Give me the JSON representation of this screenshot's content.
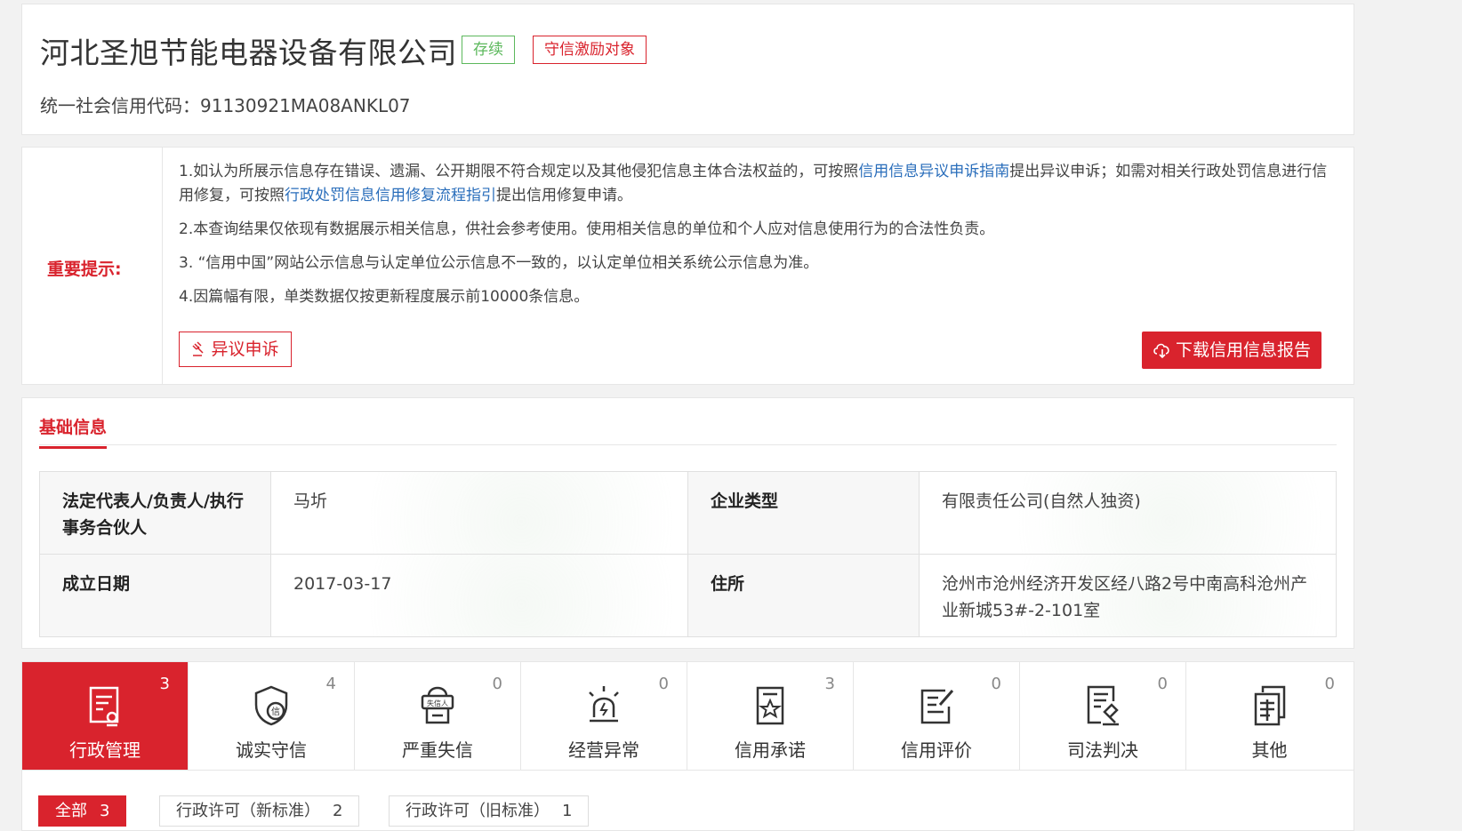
{
  "company": {
    "name": "河北圣旭节能电器设备有限公司",
    "status_tag": "存续",
    "honor_tag": "守信激励对象",
    "credit_code_label": "统一社会信用代码：",
    "credit_code": "91130921MA08ANKL07"
  },
  "notice": {
    "label": "重要提示:",
    "line1_a": "1.如认为所展示信息存在错误、遗漏、公开期限不符合规定以及其他侵犯信息主体合法权益的，可按照",
    "line1_link1": "信用信息异议申诉指南",
    "line1_b": "提出异议申诉；如需对相关行政处罚信息进行信用修复，可按照",
    "line1_link2": "行政处罚信息信用修复流程指引",
    "line1_c": "提出信用修复申请。",
    "line2": "2.本查询结果仅依现有数据展示相关信息，供社会参考使用。使用相关信息的单位和个人应对信息使用行为的合法性负责。",
    "line3": "3. “信用中国”网站公示信息与认定单位公示信息不一致的，以认定单位相关系统公示信息为准。",
    "line4": "4.因篇幅有限，单类数据仅按更新程度展示前10000条信息。",
    "objection_button": "异议申诉",
    "download_button": "下载信用信息报告"
  },
  "basic_info": {
    "section_title": "基础信息",
    "legal_rep_label": "法定代表人/负责人/执行事务合伙人",
    "legal_rep_value": "马圻",
    "type_label": "企业类型",
    "type_value": "有限责任公司(自然人独资)",
    "date_label": "成立日期",
    "date_value": "2017-03-17",
    "address_label": "住所",
    "address_value": "沧州市沧州经济开发区经八路2号中南高科沧州产业新城53#-2-101室"
  },
  "tabs": [
    {
      "label": "行政管理",
      "count": "3",
      "icon": "admin-doc-icon"
    },
    {
      "label": "诚实守信",
      "count": "4",
      "icon": "shield-credit-icon"
    },
    {
      "label": "严重失信",
      "count": "0",
      "icon": "dishonest-person-icon"
    },
    {
      "label": "经营异常",
      "count": "0",
      "icon": "alarm-light-icon"
    },
    {
      "label": "信用承诺",
      "count": "3",
      "icon": "star-document-icon"
    },
    {
      "label": "信用评价",
      "count": "0",
      "icon": "evaluation-edit-icon"
    },
    {
      "label": "司法判决",
      "count": "0",
      "icon": "judgment-gavel-icon"
    },
    {
      "label": "其他",
      "count": "0",
      "icon": "other-docs-icon"
    }
  ],
  "filters": [
    {
      "label": "全部",
      "count": "3"
    },
    {
      "label": "行政许可（新标准）",
      "count": "2"
    },
    {
      "label": "行政许可（旧标准）",
      "count": "1"
    }
  ],
  "colors": {
    "accent": "#d9232d",
    "success": "#5cb85c",
    "link": "#2a6ebb"
  }
}
